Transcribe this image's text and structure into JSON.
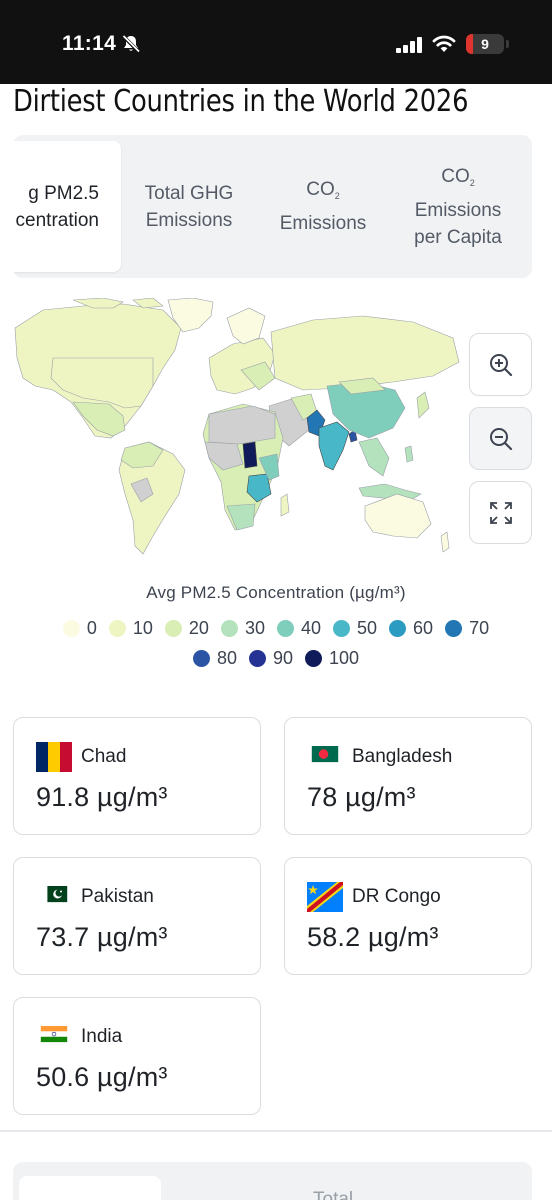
{
  "status_bar": {
    "time": "11:14",
    "battery": "9"
  },
  "page": {
    "title": "Dirtiest Countries in the World 2026"
  },
  "tabs": [
    {
      "line1": "g PM2.5",
      "line2": "centration"
    },
    {
      "label": "Total GHG Emissions"
    },
    {
      "label_main": "CO",
      "label_sub": "2",
      "label_rest": "Emissions"
    },
    {
      "label_main": "CO",
      "label_sub": "2",
      "label_rest": "Emissions per Capita"
    }
  ],
  "map": {
    "zoom_in": "zoom-in-icon",
    "zoom_out": "zoom-out-icon",
    "fullscreen": "fullscreen-icon"
  },
  "legend": {
    "title": "Avg PM2.5 Concentration (µg/m³)",
    "items": [
      {
        "label": "0",
        "color": "#fbfbe2"
      },
      {
        "label": "10",
        "color": "#eef5c3"
      },
      {
        "label": "20",
        "color": "#d8eeb4"
      },
      {
        "label": "30",
        "color": "#b4e2bd"
      },
      {
        "label": "40",
        "color": "#7fcdbb"
      },
      {
        "label": "50",
        "color": "#48b8c8"
      },
      {
        "label": "60",
        "color": "#2b9bc2"
      },
      {
        "label": "70",
        "color": "#2276b4"
      },
      {
        "label": "80",
        "color": "#2b54a5"
      },
      {
        "label": "90",
        "color": "#253494"
      },
      {
        "label": "100",
        "color": "#0f1c59"
      }
    ]
  },
  "cards": [
    {
      "country": "Chad",
      "value": "91.8 µg/m³"
    },
    {
      "country": "Bangladesh",
      "value": "78 µg/m³"
    },
    {
      "country": "Pakistan",
      "value": "73.7 µg/m³"
    },
    {
      "country": "DR Congo",
      "value": "58.2 µg/m³"
    },
    {
      "country": "India",
      "value": "50.6 µg/m³"
    }
  ],
  "next_section": {
    "tab_label": "Total"
  }
}
